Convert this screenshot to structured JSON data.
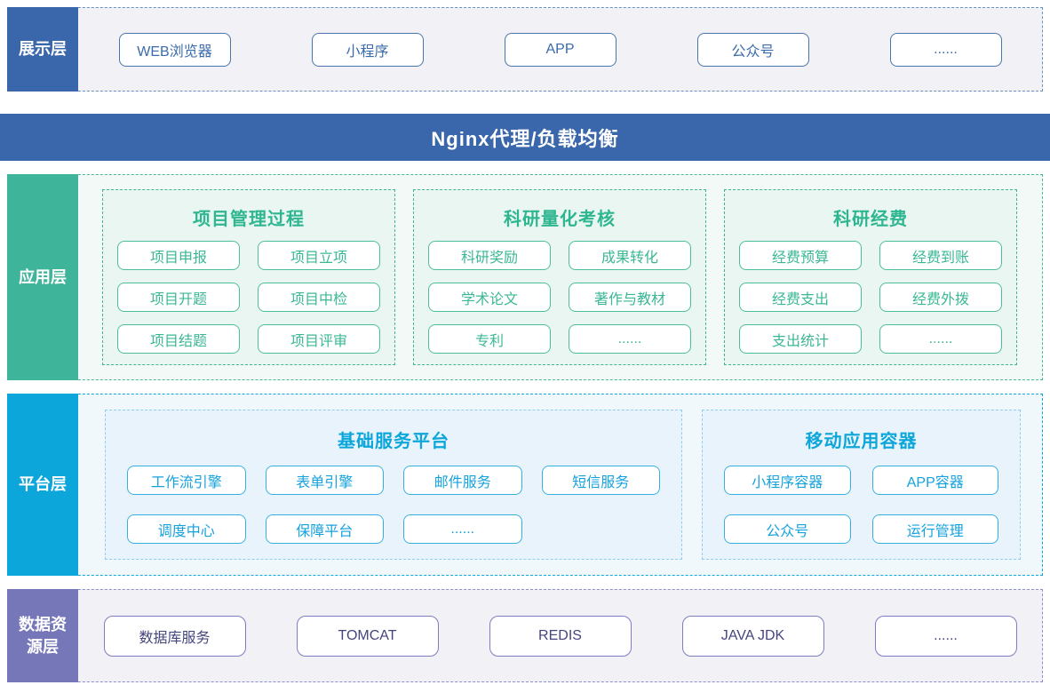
{
  "colors": {
    "primary_blue": "#3a67ab",
    "teal_green": "#3eb49a",
    "green_accent": "#2eb690",
    "cyan": "#0ca6db",
    "purple": "#7577b9",
    "purple_text": "#45457d",
    "section_bg_gray": "#f1f1f6",
    "section_bg_green": "#f2f9f6",
    "section_bg_blue": "#f1f8fc",
    "group_bg_green": "#eaf6f1",
    "group_bg_blue": "#e8f3fb"
  },
  "layers": {
    "presentation": {
      "label": "展示层",
      "items": [
        "WEB浏览器",
        "小程序",
        "APP",
        "公众号",
        "......"
      ]
    },
    "nginx": {
      "title": "Nginx代理/负载均衡"
    },
    "application": {
      "label": "应用层",
      "groups": [
        {
          "title": "项目管理过程",
          "items": [
            "项目申报",
            "项目立项",
            "项目开题",
            "项目中检",
            "项目结题",
            "项目评审"
          ]
        },
        {
          "title": "科研量化考核",
          "items": [
            "科研奖励",
            "成果转化",
            "学术论文",
            "著作与教材",
            "专利",
            "......"
          ]
        },
        {
          "title": "科研经费",
          "items": [
            "经费预算",
            "经费到账",
            "经费支出",
            "经费外拨",
            "支出统计",
            "......"
          ]
        }
      ]
    },
    "platform": {
      "label": "平台层",
      "groups": [
        {
          "title": "基础服务平台",
          "items": [
            "工作流引擎",
            "表单引擎",
            "邮件服务",
            "短信服务",
            "调度中心",
            "保障平台",
            "......"
          ]
        },
        {
          "title": "移动应用容器",
          "items": [
            "小程序容器",
            "APP容器",
            "公众号",
            "运行管理"
          ]
        }
      ]
    },
    "data": {
      "label": "数据资源层",
      "items": [
        "数据库服务",
        "TOMCAT",
        "REDIS",
        "JAVA JDK",
        "......"
      ]
    }
  }
}
